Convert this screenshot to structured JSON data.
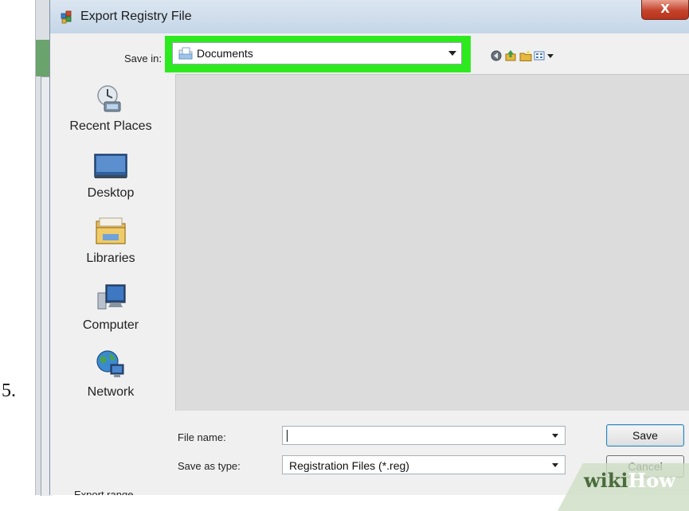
{
  "step": {
    "number": "5."
  },
  "dialog": {
    "title": "Export Registry File",
    "close_label": "X",
    "save_in": {
      "label": "Save in:",
      "value": "Documents"
    },
    "places": [
      {
        "key": "recent",
        "label": "Recent Places",
        "icon": "recent-places-icon"
      },
      {
        "key": "desktop",
        "label": "Desktop",
        "icon": "desktop-icon"
      },
      {
        "key": "libraries",
        "label": "Libraries",
        "icon": "libraries-icon"
      },
      {
        "key": "computer",
        "label": "Computer",
        "icon": "computer-icon"
      },
      {
        "key": "network",
        "label": "Network",
        "icon": "network-icon"
      }
    ],
    "file_name": {
      "label": "File name:",
      "value": ""
    },
    "save_as_type": {
      "label": "Save as type:",
      "value": "Registration Files (*.reg)"
    },
    "buttons": {
      "save": "Save",
      "cancel": "Cancel"
    },
    "export_range_label": "Export range"
  },
  "watermark": {
    "part1": "wiki",
    "part2": "How"
  },
  "colors": {
    "highlight": "#2dea1f",
    "title_bar": "#c5d6e8",
    "file_pane": "#dcdcdc"
  }
}
